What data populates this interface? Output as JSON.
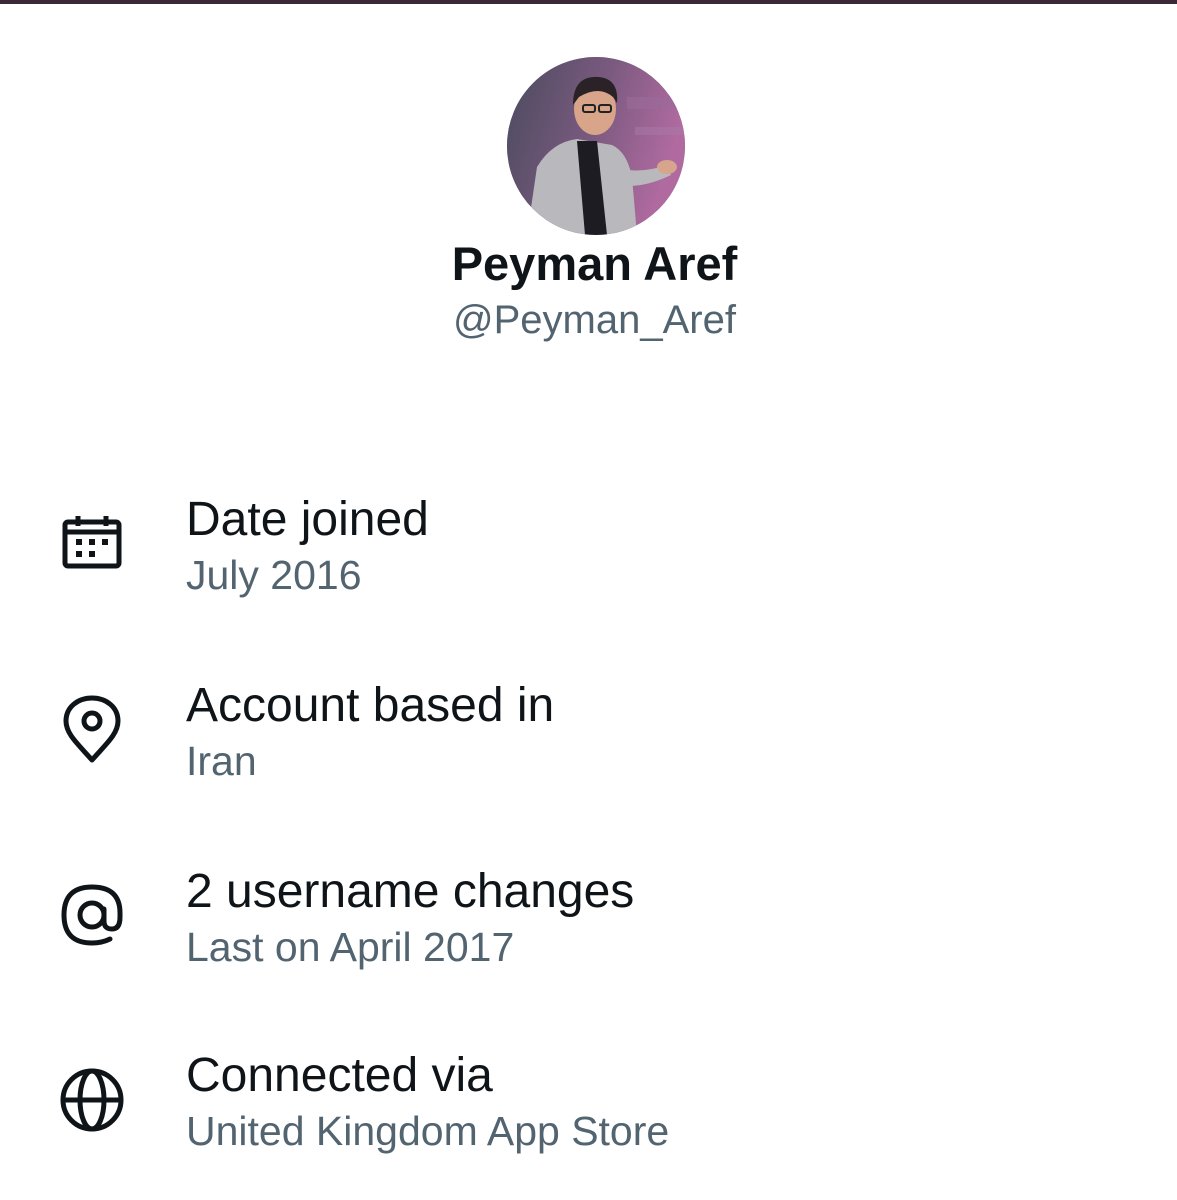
{
  "profile": {
    "display_name": "Peyman Aref",
    "handle": "@Peyman_Aref",
    "avatar_icon": "profile-photo"
  },
  "about": {
    "items": [
      {
        "icon": "calendar-icon",
        "title": "Date joined",
        "subtitle": "July 2016"
      },
      {
        "icon": "location-pin-icon",
        "title": "Account based in",
        "subtitle": "Iran"
      },
      {
        "icon": "at-sign-icon",
        "title": "2 username changes",
        "subtitle": "Last on April 2017"
      },
      {
        "icon": "globe-icon",
        "title": "Connected via",
        "subtitle": "United Kingdom App Store"
      }
    ]
  },
  "colors": {
    "primary_text": "#0f1419",
    "secondary_text": "#536471",
    "top_bar": "#3b2a36"
  }
}
